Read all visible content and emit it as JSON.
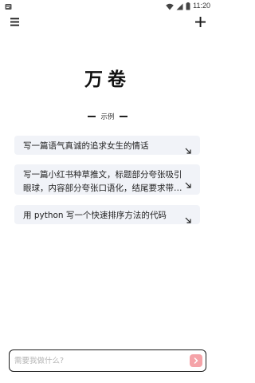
{
  "status_bar": {
    "time": "11:20",
    "icons": [
      "notification-icon",
      "wifi-icon",
      "signal-icon",
      "battery-icon"
    ]
  },
  "app_bar": {
    "menu_icon": "menu-icon",
    "add_icon": "plus-icon"
  },
  "app": {
    "title": "万卷"
  },
  "examples": {
    "header": "示例",
    "items": [
      {
        "text": "写一篇语气真诚的追求女生的情话"
      },
      {
        "text": "写一篇小红书种草推文，标题部分夸张吸引眼球，内容部分夸张口语化，结尾要求带上话题标签"
      },
      {
        "text": "用 python 写一个快速排序方法的代码"
      }
    ]
  },
  "input": {
    "placeholder": "需要我做什么?",
    "value": ""
  },
  "colors": {
    "card_bg": "#f1f3f8",
    "send_button": "#f5a3a8",
    "text": "#222222"
  }
}
